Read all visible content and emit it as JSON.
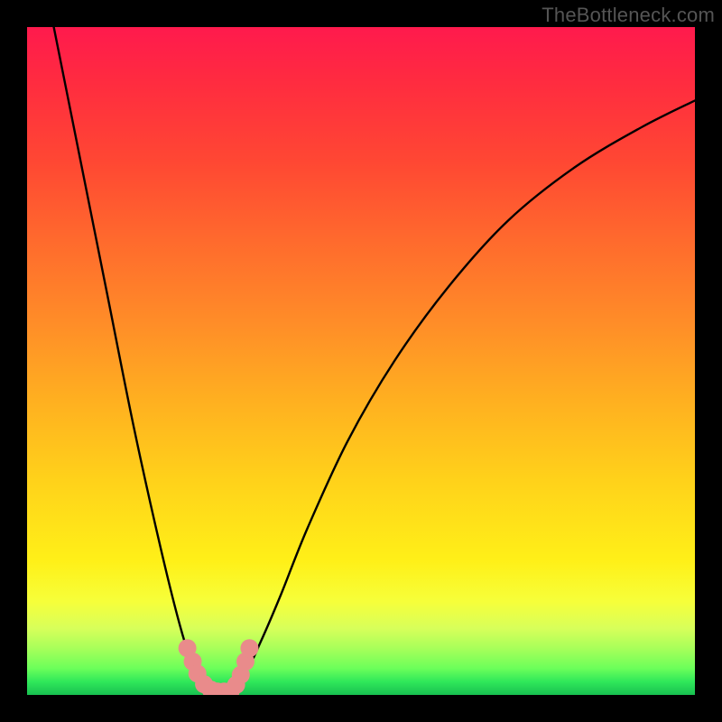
{
  "attribution": "TheBottleneck.com",
  "gradient_colors": {
    "top": "#ff1a4d",
    "mid1": "#ff8c28",
    "mid2": "#ffd21a",
    "band": "#fff018",
    "green_light": "#6cff5a",
    "green_dark": "#18c050"
  },
  "chart_data": {
    "type": "line",
    "title": "",
    "xlabel": "",
    "ylabel": "",
    "xlim": [
      0,
      100
    ],
    "ylim": [
      0,
      100
    ],
    "grid": false,
    "legend": false,
    "series": [
      {
        "name": "bottleneck-curve",
        "description": "V-shaped curve; y≈0 at optimal balance point, rises steeply on both sides toward 100.",
        "x": [
          4,
          8,
          12,
          16,
          20,
          23,
          25,
          27,
          28,
          29,
          30,
          33,
          35,
          38,
          42,
          48,
          55,
          63,
          72,
          82,
          92,
          100
        ],
        "y": [
          100,
          80,
          60,
          40,
          22,
          10,
          4,
          1,
          0,
          0,
          1,
          4,
          8,
          15,
          25,
          38,
          50,
          61,
          71,
          79,
          85,
          89
        ]
      }
    ],
    "markers": [
      {
        "name": "bottleneck-markers",
        "color": "#e98b8b",
        "points": [
          {
            "x": 24.0,
            "y": 7.0
          },
          {
            "x": 24.8,
            "y": 5.0
          },
          {
            "x": 25.5,
            "y": 3.2
          },
          {
            "x": 26.5,
            "y": 1.6
          },
          {
            "x": 27.5,
            "y": 0.8
          },
          {
            "x": 28.5,
            "y": 0.5
          },
          {
            "x": 29.5,
            "y": 0.5
          },
          {
            "x": 30.5,
            "y": 0.6
          },
          {
            "x": 31.3,
            "y": 1.5
          },
          {
            "x": 32.0,
            "y": 3.0
          },
          {
            "x": 32.7,
            "y": 5.0
          },
          {
            "x": 33.3,
            "y": 7.0
          }
        ]
      }
    ]
  }
}
